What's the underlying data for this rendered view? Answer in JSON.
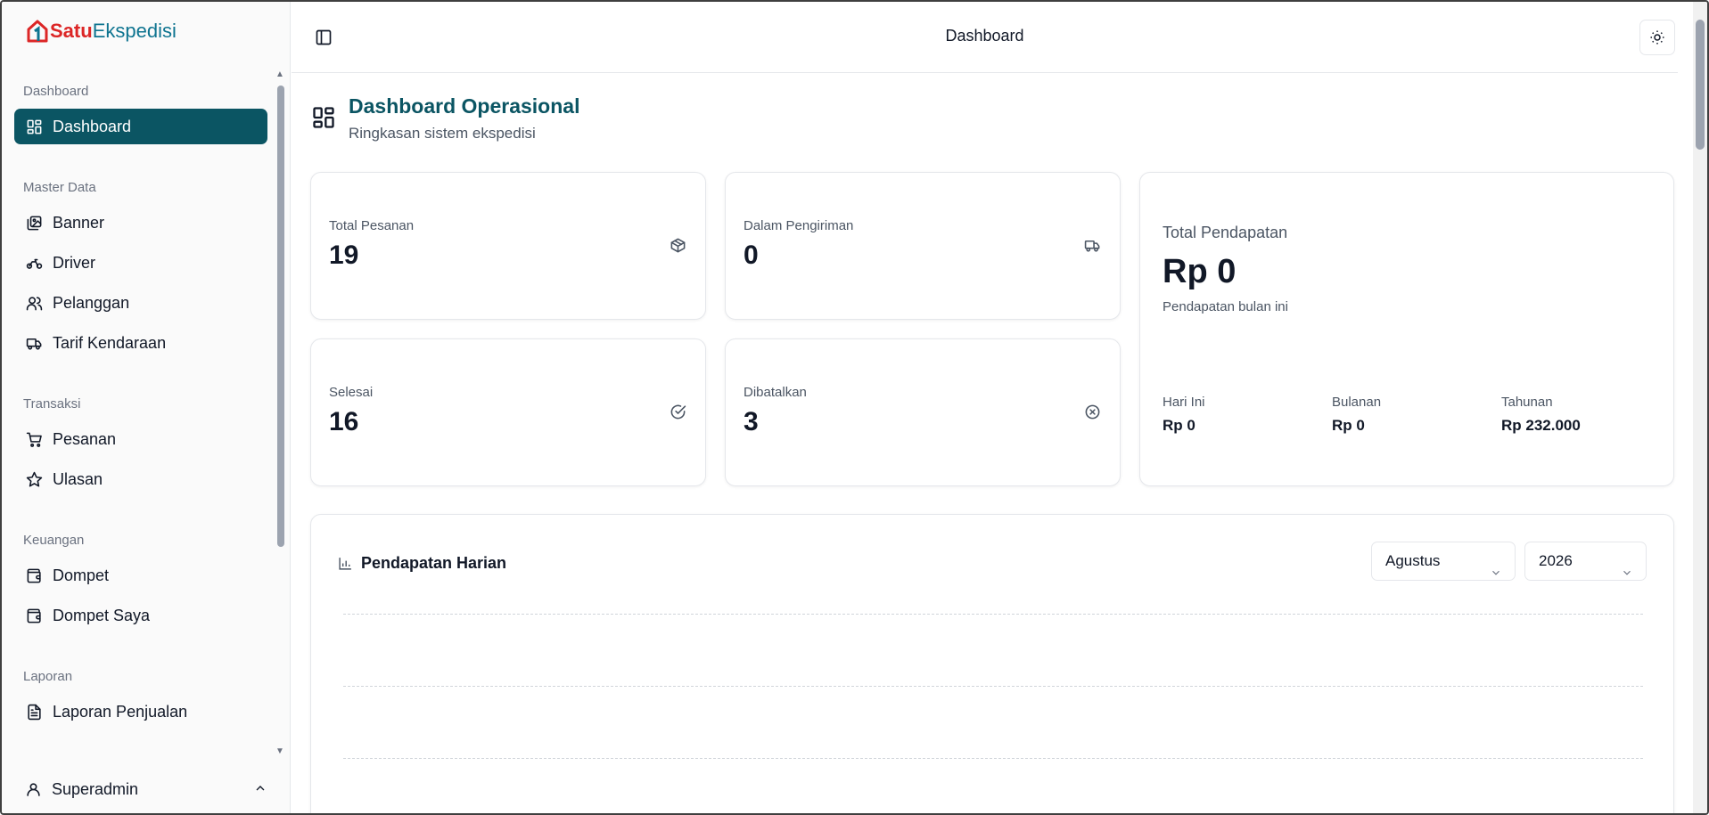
{
  "app": {
    "logo_satu": "Satu",
    "logo_ekspedisi": "Ekspedisi"
  },
  "sidebar": {
    "groups": [
      {
        "label": "Dashboard",
        "items": [
          {
            "label": "Dashboard",
            "icon": "layout-grid-icon",
            "active": true
          }
        ]
      },
      {
        "label": "Master Data",
        "items": [
          {
            "label": "Banner",
            "icon": "image-icon"
          },
          {
            "label": "Driver",
            "icon": "motorbike-icon"
          },
          {
            "label": "Pelanggan",
            "icon": "users-icon"
          },
          {
            "label": "Tarif Kendaraan",
            "icon": "truck-icon"
          }
        ]
      },
      {
        "label": "Transaksi",
        "items": [
          {
            "label": "Pesanan",
            "icon": "cart-icon"
          },
          {
            "label": "Ulasan",
            "icon": "star-icon"
          }
        ]
      },
      {
        "label": "Keuangan",
        "items": [
          {
            "label": "Dompet",
            "icon": "wallet-icon"
          },
          {
            "label": "Dompet Saya",
            "icon": "wallet-icon"
          }
        ]
      },
      {
        "label": "Laporan",
        "items": [
          {
            "label": "Laporan Penjualan",
            "icon": "file-text-icon"
          }
        ]
      }
    ],
    "user": {
      "name": "Superadmin"
    }
  },
  "topbar": {
    "title": "Dashboard"
  },
  "page": {
    "title": "Dashboard Operasional",
    "subtitle": "Ringkasan sistem ekspedisi"
  },
  "stats": {
    "total_pesanan": {
      "label": "Total Pesanan",
      "value": "19"
    },
    "dalam_pengiriman": {
      "label": "Dalam Pengiriman",
      "value": "0"
    },
    "selesai": {
      "label": "Selesai",
      "value": "16"
    },
    "dibatalkan": {
      "label": "Dibatalkan",
      "value": "3"
    }
  },
  "revenue": {
    "label": "Total Pendapatan",
    "value": "Rp 0",
    "hint": "Pendapatan bulan ini",
    "today": {
      "label": "Hari Ini",
      "value": "Rp 0"
    },
    "monthly": {
      "label": "Bulanan",
      "value": "Rp 0"
    },
    "yearly": {
      "label": "Tahunan",
      "value": "Rp 232.000"
    }
  },
  "daily_chart": {
    "title": "Pendapatan Harian",
    "month_select": "Agustus",
    "year_select": "2026"
  },
  "colors": {
    "accent": "#0b5563",
    "logo_red": "#dc2626",
    "logo_teal": "#0e7490"
  }
}
